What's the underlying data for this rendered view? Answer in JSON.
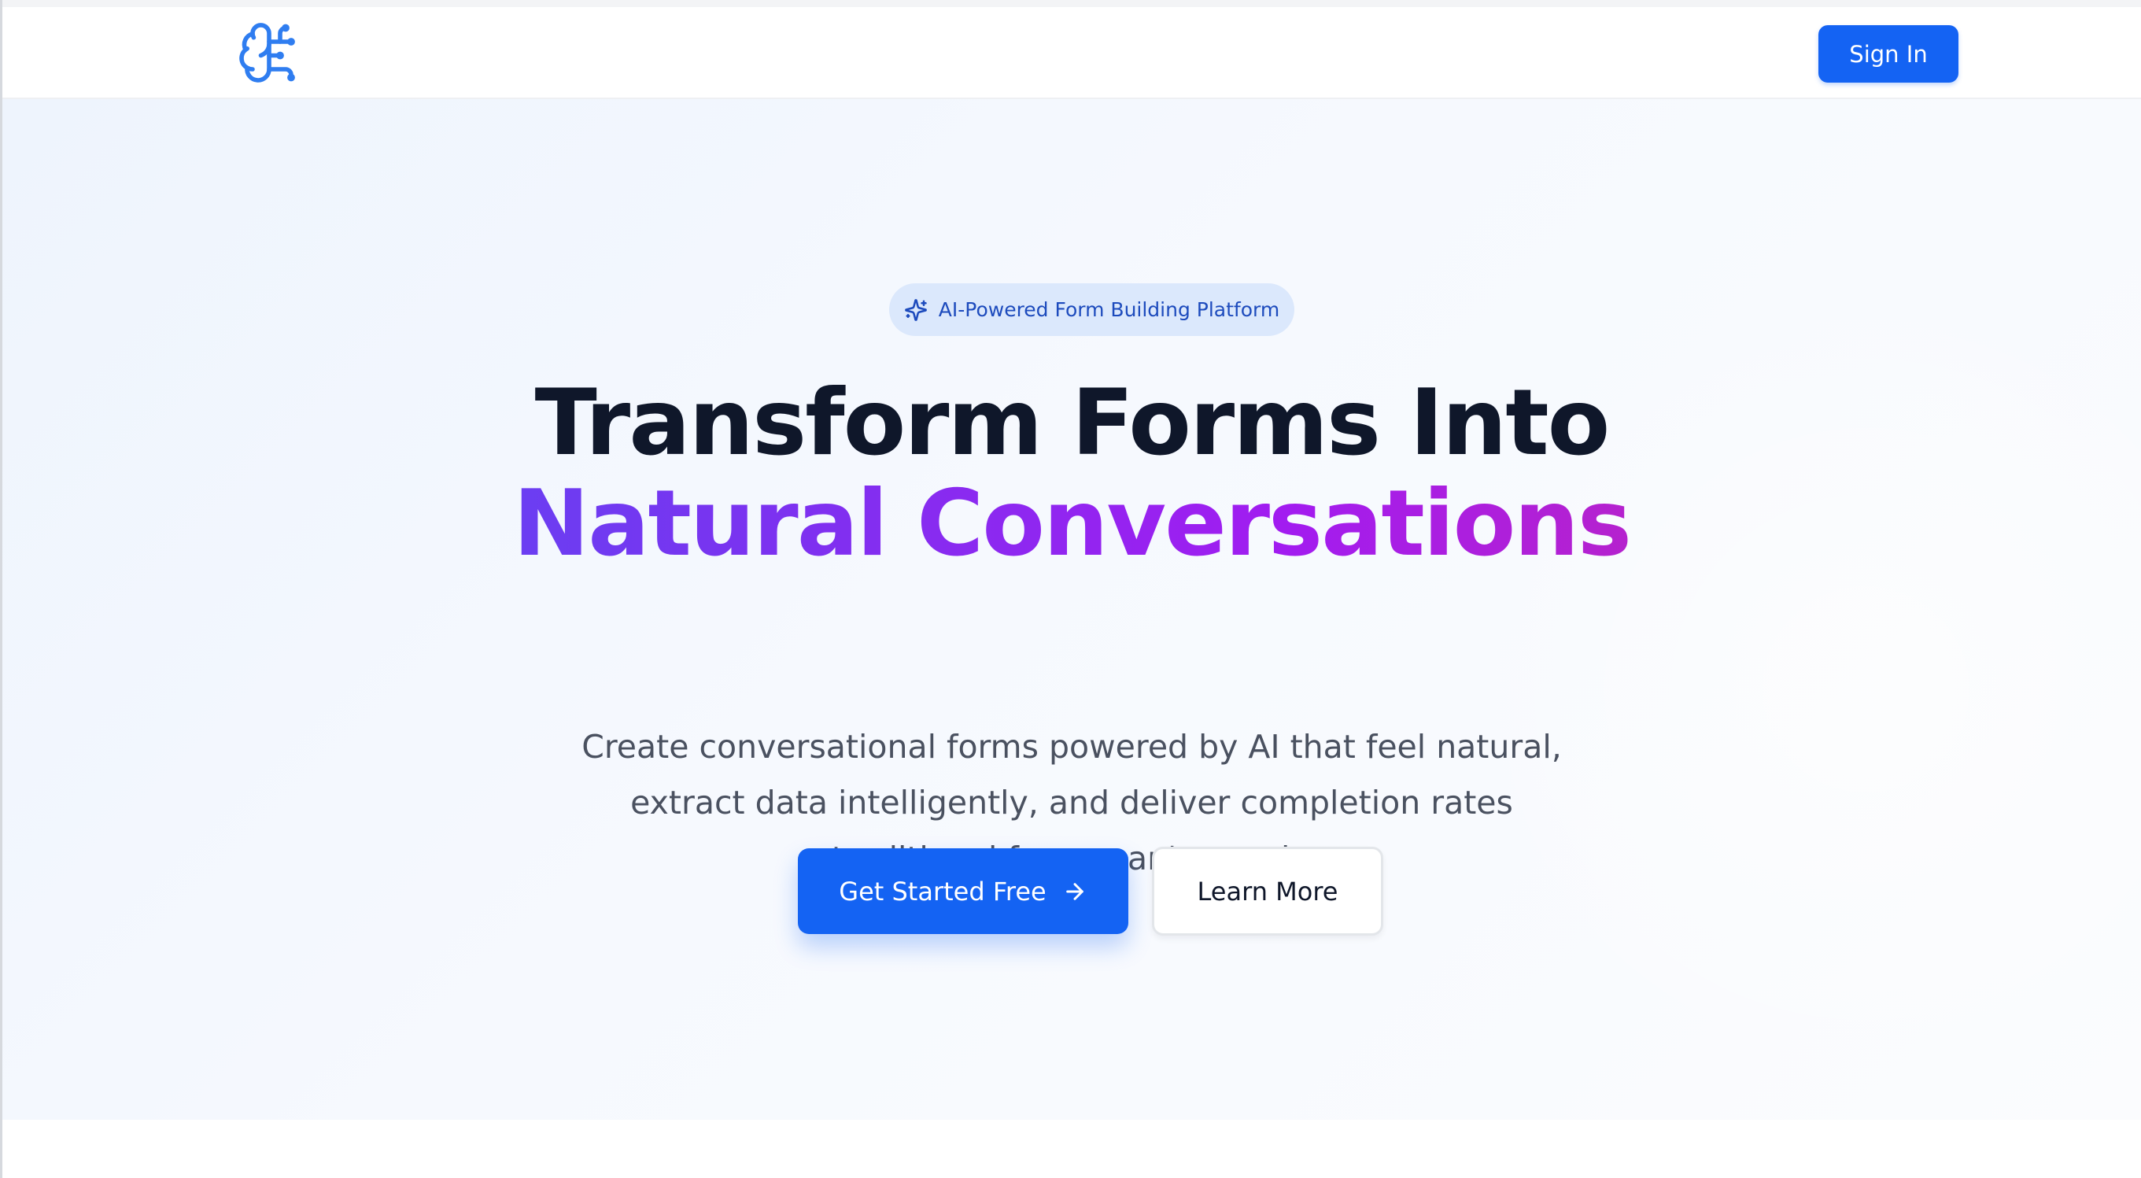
{
  "navbar": {
    "logo_icon": "brain-circuit-icon",
    "sign_in_label": "Sign In"
  },
  "hero": {
    "badge": {
      "icon": "sparkles-icon",
      "text": "AI-Powered Form Building Platform"
    },
    "headline_line1": "Transform Forms Into",
    "headline_line2": "Natural Conversations",
    "subtext": "Create conversational forms powered by AI that feel natural, extract data intelligently, and deliver completion rates traditional forms can't match.",
    "primary_cta": {
      "label": "Get Started Free",
      "icon": "arrow-right-icon"
    },
    "secondary_cta": {
      "label": "Learn More"
    }
  },
  "colors": {
    "accent": "#1463f3",
    "headline": "#0f172a",
    "gradient_start": "#4b55f5",
    "gradient_mid": "#a21cf0",
    "gradient_end": "#d22a9b",
    "badge_bg": "#dbe8fc",
    "badge_text": "#1d4bbd",
    "body_text": "#4a5160"
  }
}
